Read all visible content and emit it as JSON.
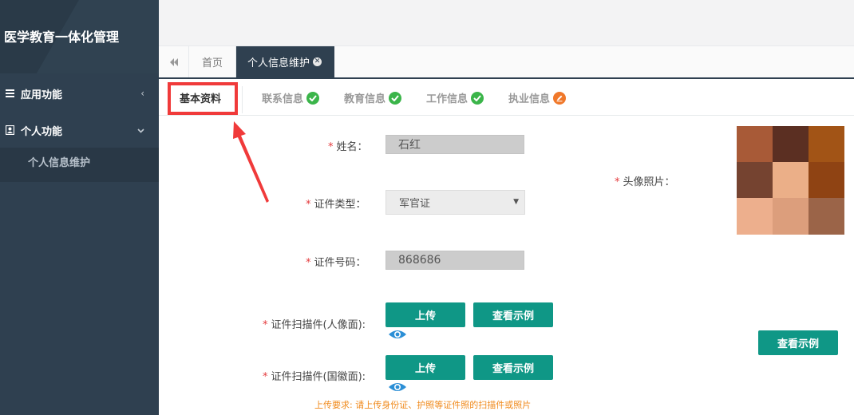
{
  "app": {
    "title": "医学教育一体化管理"
  },
  "sidebar": {
    "groups": [
      {
        "label": "应用功能",
        "icon": "hamburger-icon",
        "arrow": "‹"
      },
      {
        "label": "个人功能",
        "icon": "user-icon",
        "arrow": "⌄"
      }
    ],
    "submenu": {
      "label": "个人信息维护"
    }
  },
  "tabs": {
    "back_icon": "double-chevron-left-icon",
    "home": "首页",
    "active": "个人信息维护",
    "close_icon": "close-circle-icon"
  },
  "subtabs": [
    {
      "label": "基本资料",
      "status": ""
    },
    {
      "label": "联系信息",
      "status": "complete"
    },
    {
      "label": "教育信息",
      "status": "complete"
    },
    {
      "label": "工作信息",
      "status": "complete"
    },
    {
      "label": "执业信息",
      "status": "editing"
    }
  ],
  "form": {
    "name": {
      "label": "姓名：",
      "value": "石红"
    },
    "id_type": {
      "label": "证件类型：",
      "value": "军官证"
    },
    "id_number": {
      "label": "证件号码：",
      "value": "868686"
    },
    "scan_front": {
      "label": "证件扫描件(人像面):",
      "upload": "上传",
      "example": "查看示例"
    },
    "scan_back": {
      "label": "证件扫描件(国徽面):",
      "upload": "上传",
      "example": "查看示例"
    },
    "photo": {
      "label": "头像照片：",
      "example": "查看示例"
    },
    "required_mark": "*",
    "hint": "上传要求: 请上传身份证、护照等证件照的扫描件或照片"
  },
  "colors": {
    "sidebar": "#2f4050",
    "accent": "#0f9786",
    "required": "#e4393c",
    "check": "#3bb54a",
    "edit": "#f0782a",
    "hint": "#f08a1c",
    "annotation": "#f03a3a"
  },
  "photo_pixels": [
    "#a85a37",
    "#5b2f22",
    "#a25416",
    "#754330",
    "#ebaf88",
    "#8f4313",
    "#edaf8d",
    "#dc9e7c",
    "#9b6448"
  ]
}
